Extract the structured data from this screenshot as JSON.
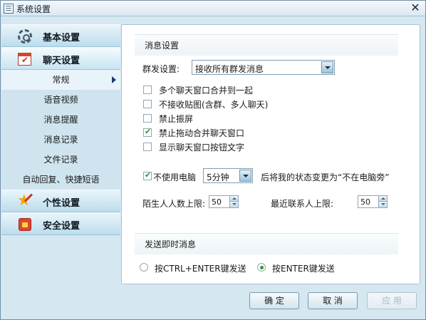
{
  "window": {
    "title": "系统设置"
  },
  "sidebar": {
    "categories": [
      {
        "label": "基本设置",
        "icon": "gear-icon"
      },
      {
        "label": "聊天设置",
        "icon": "calendar-check-icon"
      },
      {
        "label": "个性设置",
        "icon": "star-icon"
      },
      {
        "label": "安全设置",
        "icon": "shield-icon"
      }
    ],
    "chat_subitems": [
      "常规",
      "语音视频",
      "消息提醒",
      "消息记录",
      "文件记录",
      "自动回复、快捷短语"
    ],
    "selected_subitem": "常规"
  },
  "message_settings": {
    "title": "消息设置",
    "group_send_label": "群发设置:",
    "group_send_value": "接收所有群发消息",
    "options": [
      {
        "label": "多个聊天窗口合并到一起",
        "checked": false
      },
      {
        "label": "不接收贴图(含群、多人聊天)",
        "checked": false
      },
      {
        "label": "禁止振屏",
        "checked": false
      },
      {
        "label": "禁止拖动合并聊天窗口",
        "checked": true
      },
      {
        "label": "显示聊天窗口按钮文字",
        "checked": false
      }
    ],
    "away": {
      "label": "不使用电脑",
      "checked": true,
      "minutes_value": "5分钟",
      "suffix": "后将我的状态变更为“不在电脑旁”"
    },
    "stranger_limit_label": "陌生人人数上限:",
    "stranger_limit_value": "50",
    "recent_limit_label": "最近联系人上限:",
    "recent_limit_value": "50"
  },
  "send_settings": {
    "title": "发送即时消息",
    "options": [
      {
        "label": "按CTRL+ENTER键发送",
        "selected": false
      },
      {
        "label": "按ENTER键发送",
        "selected": true
      }
    ]
  },
  "footer": {
    "ok_label": "确 定",
    "cancel_label": "取 消",
    "apply_label": "应 用"
  }
}
